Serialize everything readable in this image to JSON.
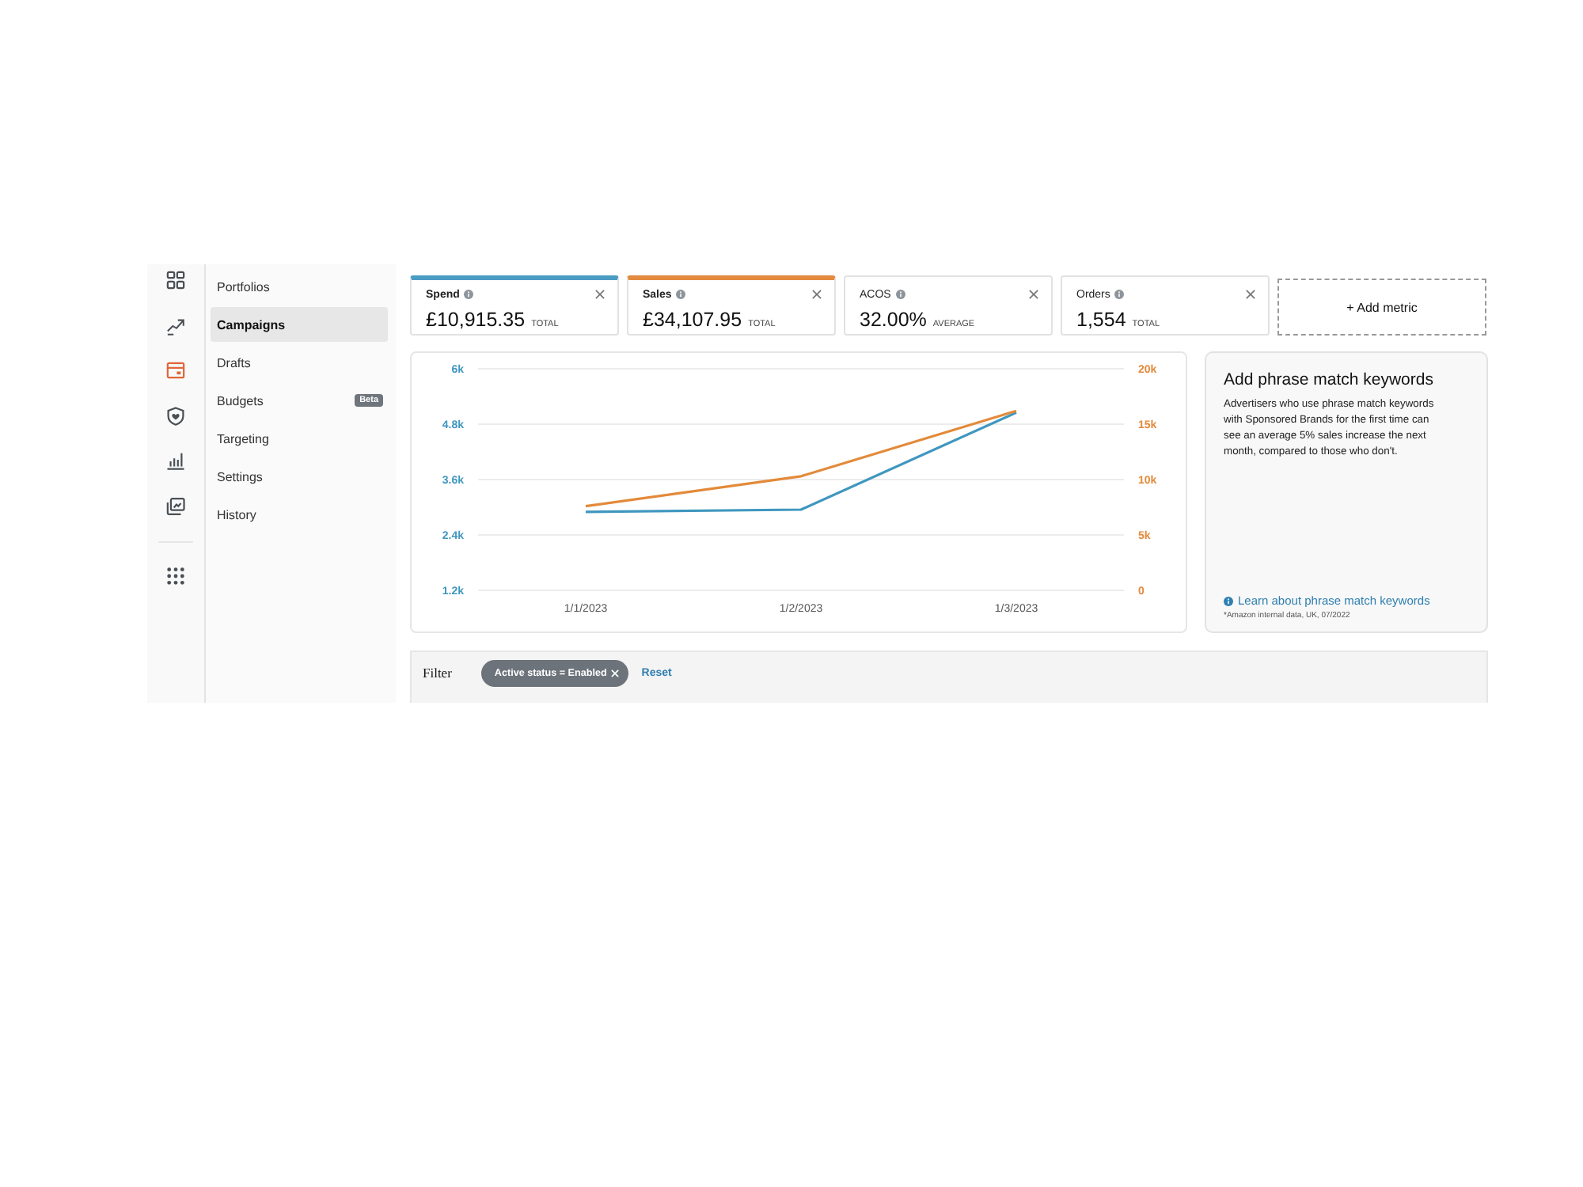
{
  "rail": {
    "items": [
      {
        "selected": false
      },
      {
        "selected": false
      },
      {
        "selected": true
      },
      {
        "selected": false
      },
      {
        "selected": false
      },
      {
        "selected": false
      }
    ]
  },
  "sidebar": {
    "items": [
      {
        "label": "Portfolios",
        "selected": false
      },
      {
        "label": "Campaigns",
        "selected": true
      },
      {
        "label": "Drafts",
        "selected": false
      },
      {
        "label": "Budgets",
        "selected": false,
        "badge": "Beta"
      },
      {
        "label": "Targeting",
        "selected": false
      },
      {
        "label": "Settings",
        "selected": false
      },
      {
        "label": "History",
        "selected": false
      }
    ]
  },
  "metrics": [
    {
      "label": "Spend",
      "value": "£10,915.35",
      "unit": "TOTAL",
      "selected": true,
      "color": "#4a9cc4"
    },
    {
      "label": "Sales",
      "value": "£34,107.95",
      "unit": "TOTAL",
      "selected": true,
      "color": "#e38a3f"
    },
    {
      "label": "ACOS",
      "value": "32.00%",
      "unit": "AVERAGE",
      "selected": false
    },
    {
      "label": "Orders",
      "value": "1,554",
      "unit": "TOTAL",
      "selected": false
    }
  ],
  "add_metric": "+ Add metric",
  "chart": {
    "chart_data": {
      "type": "line",
      "categories": [
        "1/1/2023",
        "1/2/2023",
        "1/3/2023"
      ],
      "series": [
        {
          "color": "#3f97bf",
          "values": [
            2900,
            2950,
            5050
          ]
        },
        {
          "color": "#e38a3a",
          "axis": "y2",
          "values": [
            7600,
            10300,
            16200
          ]
        }
      ],
      "ylim": [
        1200,
        6000
      ],
      "yticks": [
        {
          "value": 1200,
          "label": "1.2k"
        },
        {
          "value": 2400,
          "label": "2.4k"
        },
        {
          "value": 3600,
          "label": "3.6k"
        },
        {
          "value": 4800,
          "label": "4.8k"
        },
        {
          "value": 6000,
          "label": "6k"
        }
      ],
      "y2lim": [
        0,
        20000
      ],
      "y2ticks": [
        {
          "value": 0,
          "label": "0"
        },
        {
          "value": 5000,
          "label": "5k"
        },
        {
          "value": 10000,
          "label": "10k"
        },
        {
          "value": 15000,
          "label": "15k"
        },
        {
          "value": 20000,
          "label": "20k"
        }
      ],
      "grid": true
    }
  },
  "promo": {
    "title": "Add phrase match keywords",
    "body": "Advertisers who use phrase match keywords with Sponsored Brands for the first time can see an average 5% sales increase the next month, compared to those who don't.",
    "link": "Learn about phrase match keywords",
    "footnote": "*Amazon internal data, UK, 07/2022"
  },
  "filter": {
    "label": "Filter",
    "chips": [
      {
        "text": "Active status = Enabled"
      }
    ],
    "reset": "Reset"
  }
}
